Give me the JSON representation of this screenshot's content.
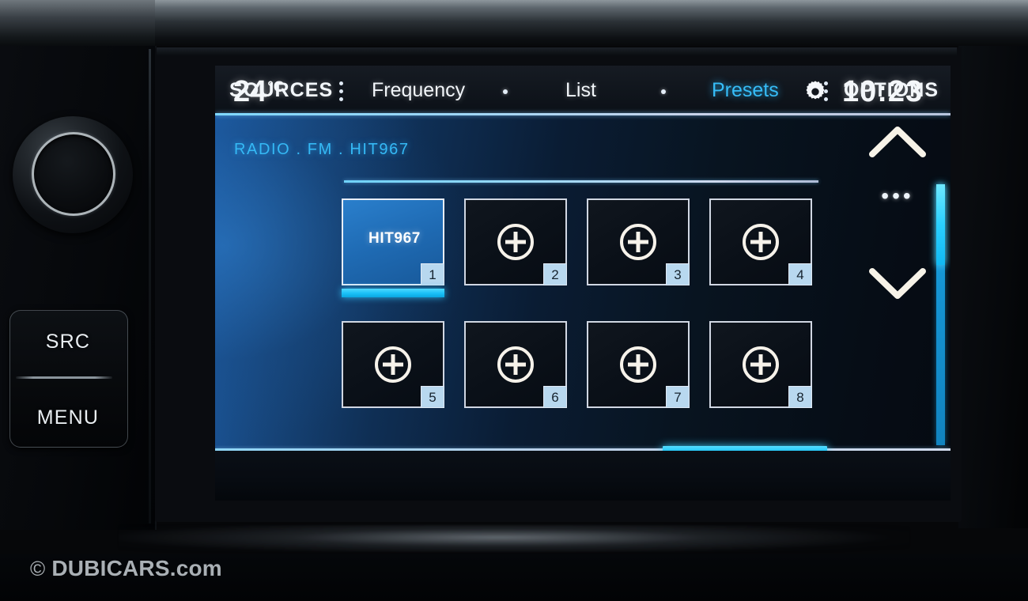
{
  "device": {
    "knob_name": "volume-knob",
    "buttons": [
      {
        "id": "src",
        "label": "SRC"
      },
      {
        "id": "menu",
        "label": "MENU"
      }
    ]
  },
  "screen": {
    "status_bar": {
      "temperature": "24",
      "temperature_unit": "°C",
      "settings_icon": "gear-icon",
      "time": "10:23"
    },
    "breadcrumb": "RADIO . FM . HIT967",
    "presets": {
      "add_icon": "plus-circle-icon",
      "tiles": [
        {
          "number": "1",
          "label": "HIT967",
          "filled": true
        },
        {
          "number": "2",
          "label": "",
          "filled": false
        },
        {
          "number": "3",
          "label": "",
          "filled": false
        },
        {
          "number": "4",
          "label": "",
          "filled": false
        },
        {
          "number": "5",
          "label": "",
          "filled": false
        },
        {
          "number": "6",
          "label": "",
          "filled": false
        },
        {
          "number": "7",
          "label": "",
          "filled": false
        },
        {
          "number": "8",
          "label": "",
          "filled": false
        }
      ]
    },
    "side_nav": {
      "up_icon": "chevron-up-icon",
      "dots": "•••",
      "down_icon": "chevron-down-icon"
    },
    "bottom_bar": {
      "sources": "SOURCES",
      "frequency": "Frequency",
      "list": "List",
      "presets": "Presets",
      "options": "OPTIONS",
      "active_tab": "Presets"
    }
  },
  "watermark": {
    "symbol": "©",
    "text": "DUBICARS.com"
  },
  "colors": {
    "accent_cyan": "#2ac6fa",
    "breadcrumb_blue": "#35b9f5",
    "tile_selected": "#1f6bb4",
    "badge_bg": "#b8d8ef",
    "text_white": "#f4f7fa"
  }
}
